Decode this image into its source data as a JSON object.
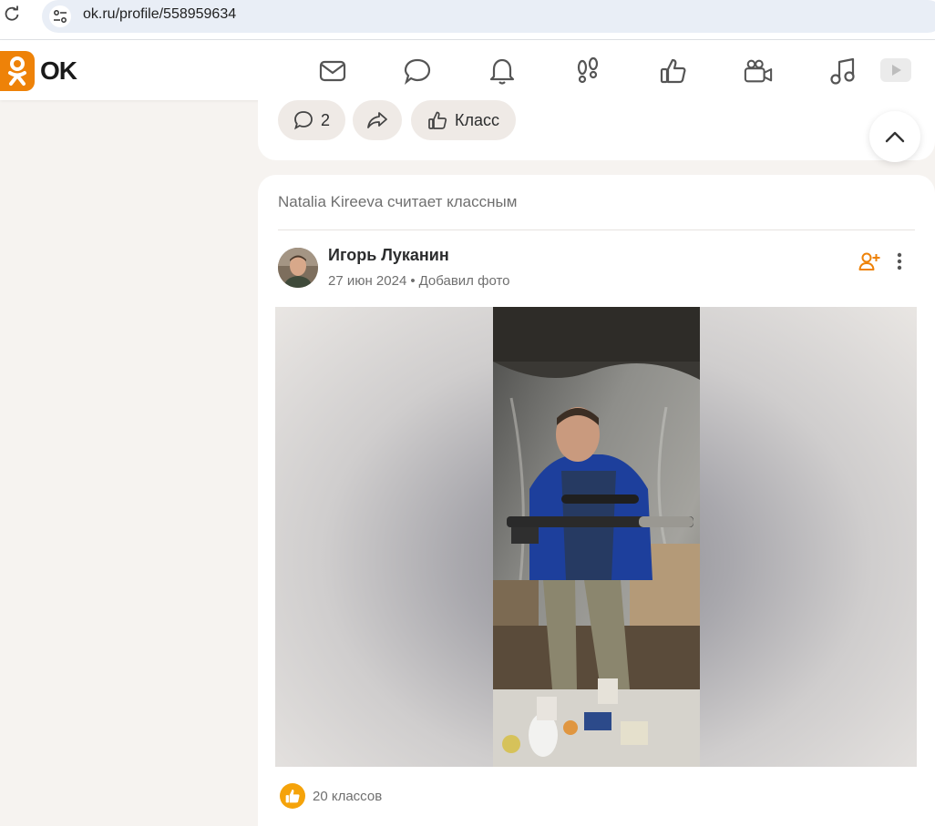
{
  "browser": {
    "url": "ok.ru/profile/558959634"
  },
  "header": {
    "logo_text": "OK",
    "nav_icons": [
      "mail-icon",
      "chat-icon",
      "bell-icon",
      "footprints-icon",
      "like-icon",
      "video-camera-icon",
      "music-icon",
      "video-tab-icon"
    ]
  },
  "prev_post": {
    "comments_count": "2",
    "class_label": "Класс"
  },
  "post": {
    "liked_by_text": "Natalia Kireeva считает классным",
    "author_name": "Игорь Луканин",
    "date": "27 июн 2024",
    "separator": "•",
    "action": "Добавил фото",
    "likes_text": "20 классов"
  },
  "colors": {
    "brand_orange": "#ee8208",
    "like_yellow": "#f5a30a",
    "page_bg": "#f6f3f0"
  }
}
